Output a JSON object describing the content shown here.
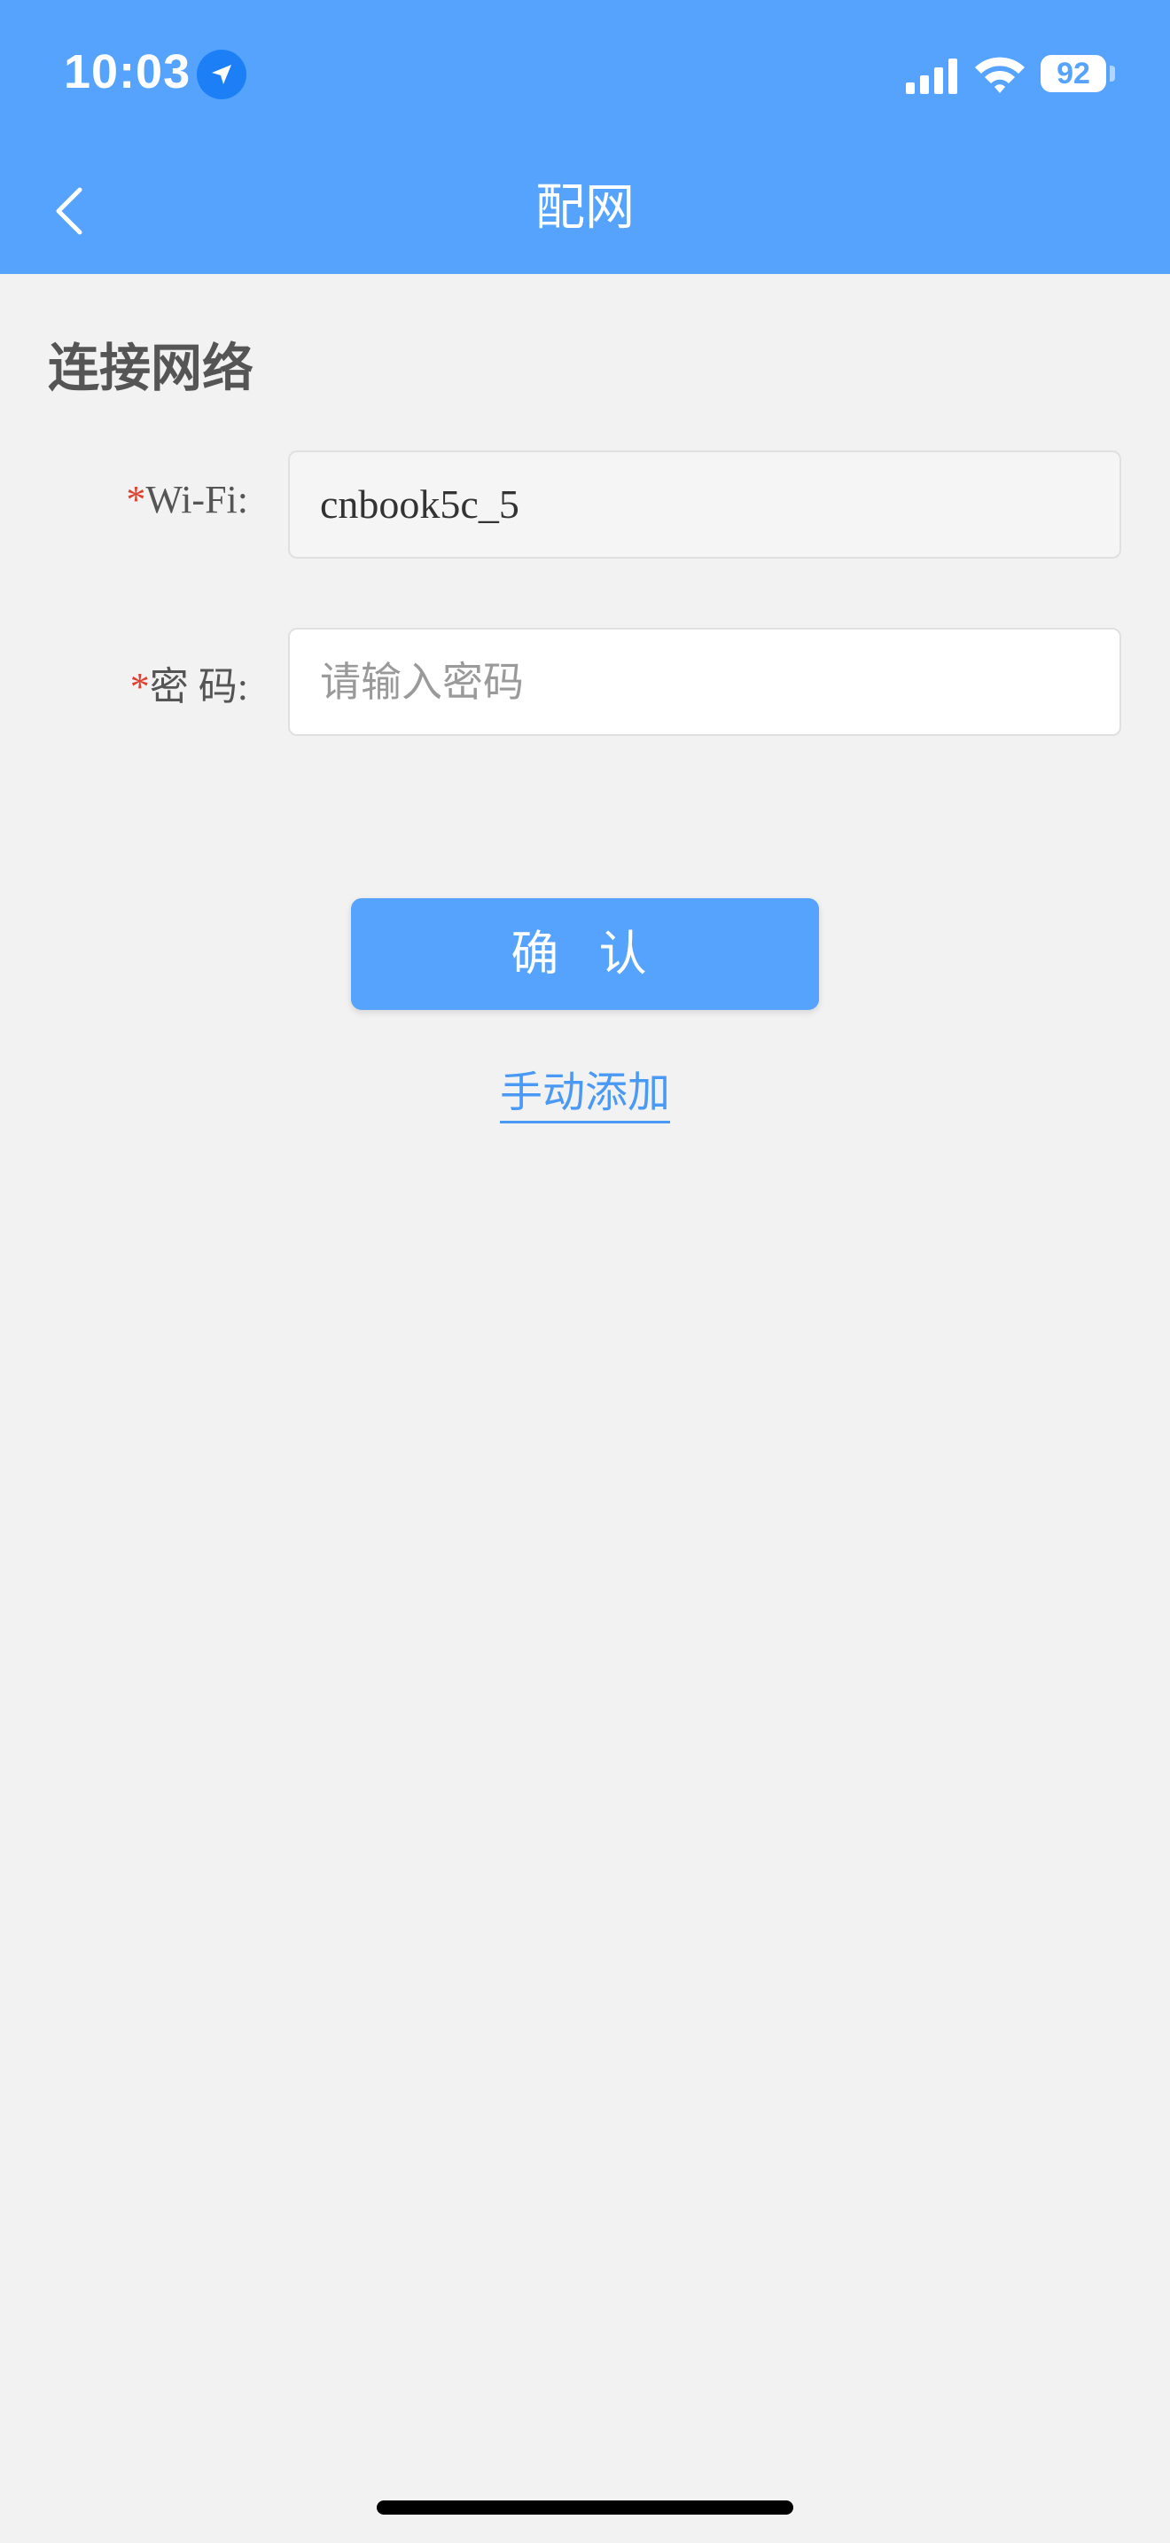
{
  "status_bar": {
    "time": "10:03",
    "battery": "92"
  },
  "nav": {
    "title": "配网",
    "back_icon": "chevron-left-icon"
  },
  "section": {
    "title": "连接网络"
  },
  "form": {
    "wifi": {
      "required_mark": "*",
      "label": "Wi-Fi:",
      "value": "cnbook5c_5"
    },
    "password": {
      "required_mark": "*",
      "label": "密 码:",
      "placeholder": "请输入密码"
    }
  },
  "actions": {
    "confirm_label": "确 认",
    "manual_add_label": "手动添加"
  },
  "colors": {
    "header": "#55a3fd",
    "primary_button": "#55a3fd",
    "link": "#4a9af5",
    "required": "#e2402f",
    "background": "#f2f2f2"
  }
}
